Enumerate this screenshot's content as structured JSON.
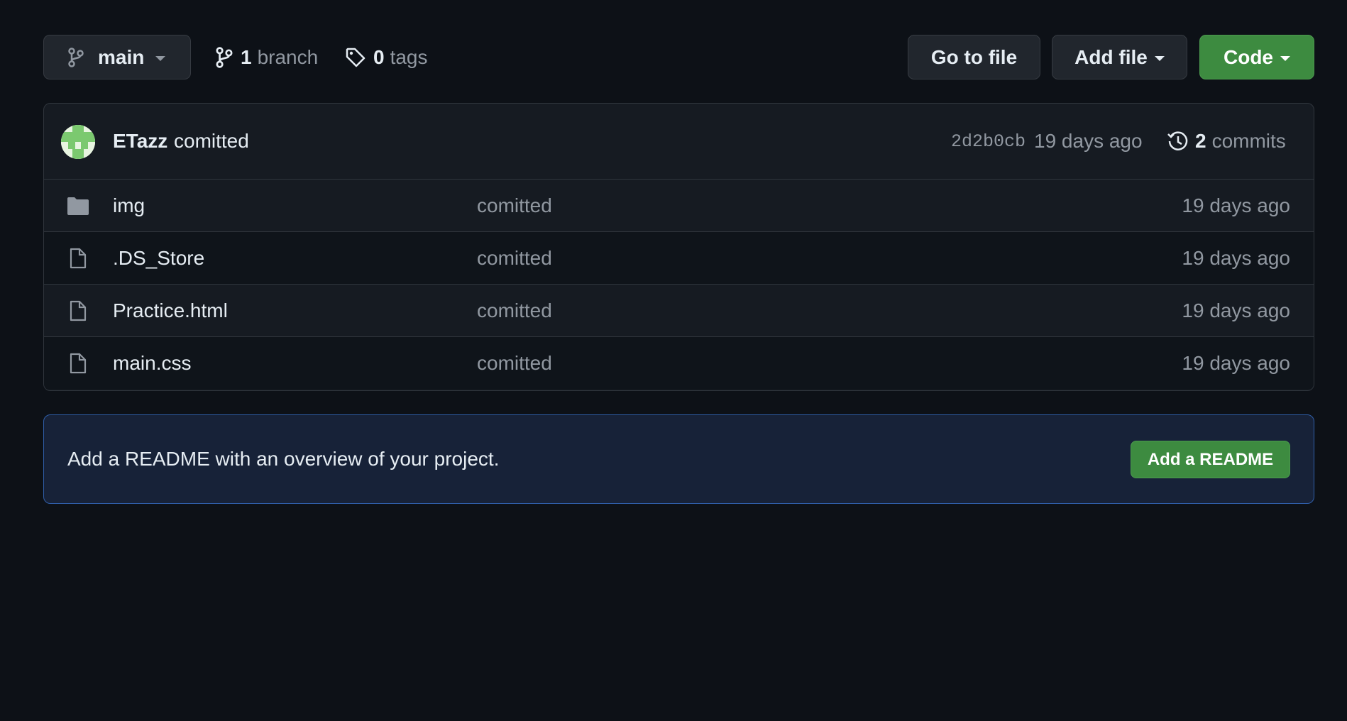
{
  "toolbar": {
    "branch_selector": "main",
    "branch_count": "1",
    "branch_label": "branch",
    "tag_count": "0",
    "tag_label": "tags",
    "go_to_file": "Go to file",
    "add_file": "Add file",
    "code": "Code"
  },
  "commit": {
    "author": "ETazz",
    "message": "comitted",
    "sha": "2d2b0cb",
    "time": "19 days ago",
    "commit_count": "2",
    "commits_label": "commits"
  },
  "files": [
    {
      "icon": "folder-icon",
      "name": "img",
      "commit_message": "comitted",
      "time": "19 days ago"
    },
    {
      "icon": "file-icon",
      "name": ".DS_Store",
      "commit_message": "comitted",
      "time": "19 days ago"
    },
    {
      "icon": "file-icon",
      "name": "Practice.html",
      "commit_message": "comitted",
      "time": "19 days ago"
    },
    {
      "icon": "file-icon",
      "name": "main.css",
      "commit_message": "comitted",
      "time": "19 days ago"
    }
  ],
  "readme": {
    "prompt": "Add a README with an overview of your project.",
    "button": "Add a README"
  },
  "colors": {
    "background": "#0d1117",
    "accent_green": "#3d8b40",
    "readme_border": "#2f5ea8"
  }
}
